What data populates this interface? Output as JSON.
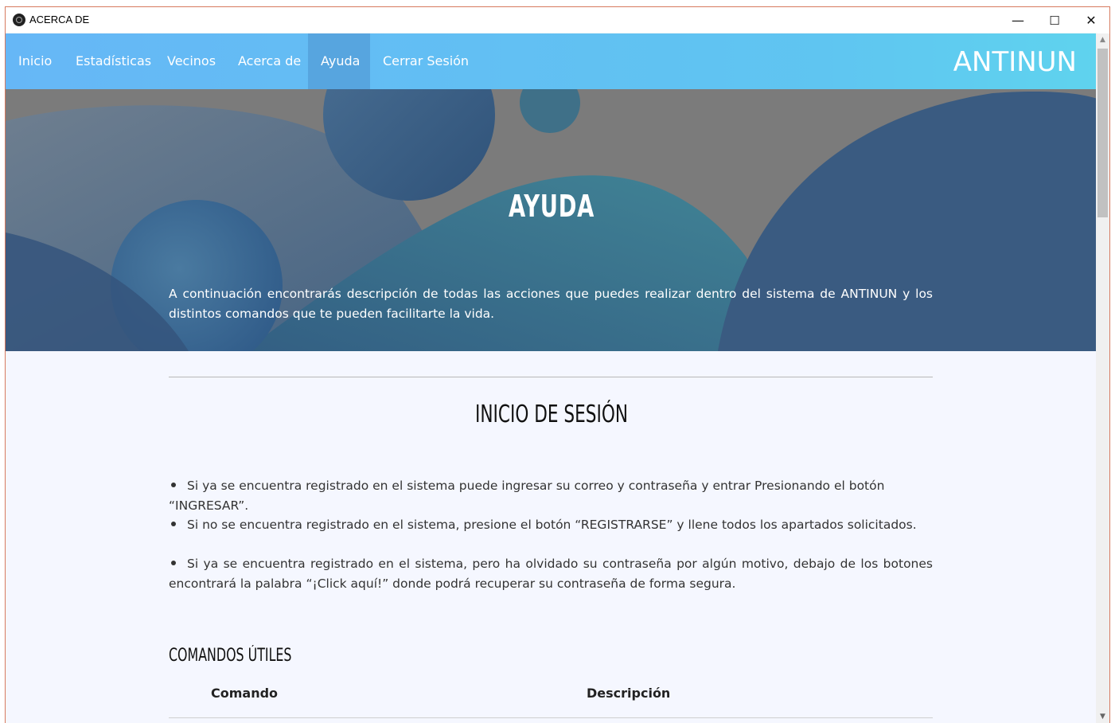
{
  "window": {
    "title": "ACERCA DE",
    "controls": {
      "minimize": "—",
      "maximize": "☐",
      "close": "✕"
    }
  },
  "nav": {
    "items": [
      {
        "label": "Inicio",
        "active": false
      },
      {
        "label": "Estadísticas",
        "active": false
      },
      {
        "label": "Vecinos",
        "active": false
      },
      {
        "label": "Acerca de",
        "active": false
      },
      {
        "label": "Ayuda",
        "active": true
      },
      {
        "label": "Cerrar Sesión",
        "active": false
      }
    ],
    "brand": "ANTINUN"
  },
  "hero": {
    "title": "AYUDA",
    "description": "A continuación encontrarás descripción de todas las acciones que puedes realizar dentro del sistema de ANTINUN y los distintos comandos que te pueden facilitarte la vida."
  },
  "section": {
    "title": "INICIO DE SESIÓN",
    "bullets": [
      "Si ya se encuentra registrado en el sistema puede ingresar su correo y contraseña y entrar Presionando el botón “INGRESAR”.",
      "Si no se encuentra registrado en el sistema, presione el botón “REGISTRARSE” y llene todos los apartados solicitados.",
      "Si ya se encuentra registrado en el sistema, pero ha olvidado su contraseña por algún motivo, debajo de los botones encontrará la palabra “¡Click aquí!” donde podrá recuperar su contraseña de forma segura."
    ]
  },
  "commands": {
    "title": "COMANDOS ÚTILES",
    "headers": [
      "Comando",
      "Descripción"
    ]
  },
  "colors": {
    "nav_start": "#66b7f6",
    "nav_end": "#5fd3ee",
    "nav_active": "#57a5df",
    "hero_gray": "#7c7c7c",
    "hero_blue": "#3a5f86",
    "hero_teal": "#3f7288",
    "page_bg": "#f5f7ff"
  }
}
